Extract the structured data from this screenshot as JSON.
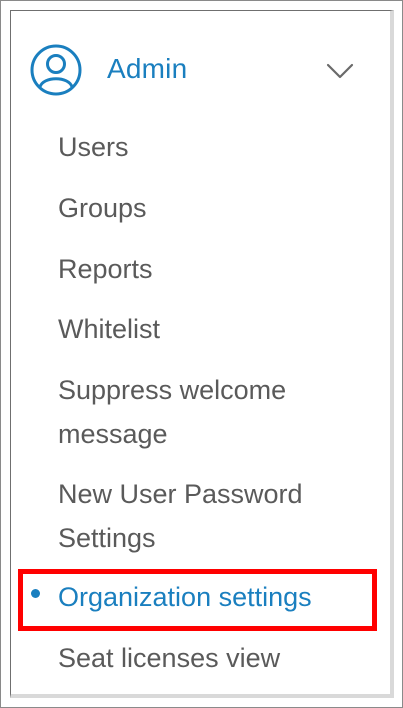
{
  "menu": {
    "header": {
      "title": "Admin",
      "icon": "user-circle-icon",
      "chevron": "chevron-down-icon",
      "expanded": true
    },
    "items": [
      {
        "label": "Users"
      },
      {
        "label": "Groups"
      },
      {
        "label": "Reports"
      },
      {
        "label": "Whitelist"
      },
      {
        "label_line1": "Suppress welcome",
        "label_line2": "message"
      },
      {
        "label_line1": "New User Password",
        "label_line2": "Settings"
      },
      {
        "label": "Organization settings",
        "active": true
      },
      {
        "label": "Seat licenses view"
      }
    ]
  },
  "colors": {
    "accent": "#1a7fbf",
    "text": "#5a5a5a",
    "highlight": "#ff0000"
  }
}
